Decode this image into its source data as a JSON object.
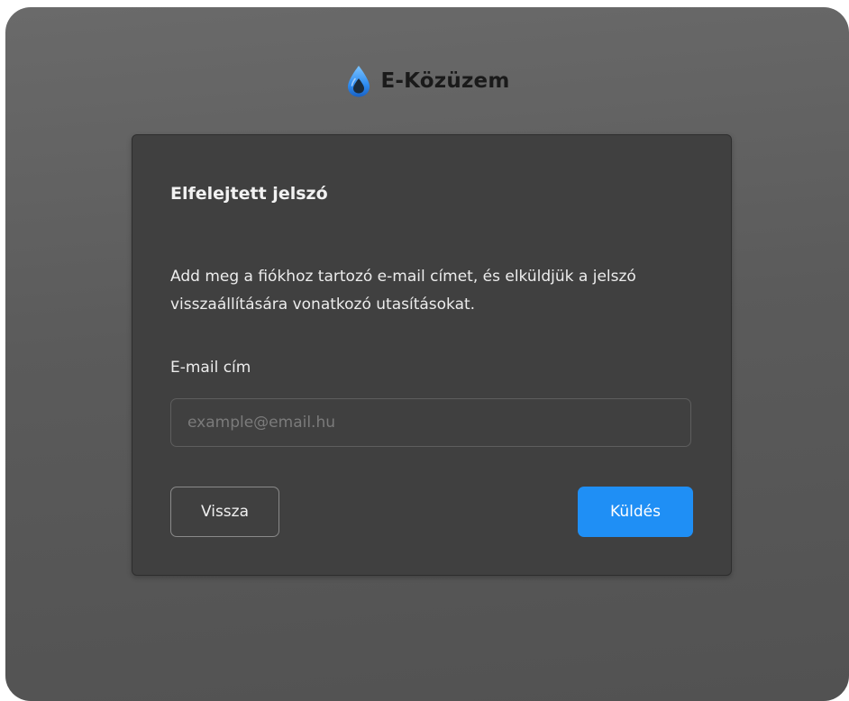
{
  "brand": {
    "name": "E-Közüzem",
    "logo_icon": "water-drop-icon",
    "drop_color": "#2f8cf0"
  },
  "form": {
    "title": "Elfelejtett jelszó",
    "description": "Add meg a fiókhoz tartozó e-mail címet, és elküldjük a jelszó visszaállítására vonatkozó utasításokat.",
    "email_label": "E-mail cím",
    "email_placeholder": "example@email.hu",
    "email_value": "",
    "back_label": "Vissza",
    "send_label": "Küldés"
  },
  "colors": {
    "accent": "#1f8ff5",
    "card_bg": "#404040",
    "page_bg": "#5e5e5e"
  }
}
